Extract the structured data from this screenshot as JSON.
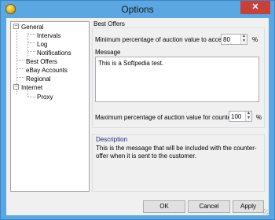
{
  "window": {
    "title": "Options",
    "close_glyph": "✕",
    "accent": "#5aa7e2",
    "close_color": "#c7403a"
  },
  "tree": {
    "items": [
      {
        "label": "General",
        "expander": "−"
      },
      {
        "label": "Intervals"
      },
      {
        "label": "Log"
      },
      {
        "label": "Notifications"
      },
      {
        "label": "Best Offers"
      },
      {
        "label": "eBay Accounts"
      },
      {
        "label": "Regional"
      },
      {
        "label": "Internet",
        "expander": "−"
      },
      {
        "label": "Proxy"
      }
    ]
  },
  "best_offers": {
    "group_label": "Best Offers",
    "min_label": "Minimum percentage of auction value to accept:",
    "min_value": "80",
    "min_unit": "%",
    "message_label": "Message",
    "message_value": "This is a Softpedia test.",
    "max_label": "Maximum percentage of auction value for counters:",
    "max_value": "100",
    "max_unit": "%"
  },
  "description": {
    "title": "Description",
    "text": "This is the message that will be included with the counter-offer when it is sent to the customer."
  },
  "buttons": {
    "ok": "OK",
    "cancel": "Cancel",
    "apply": "Apply"
  }
}
